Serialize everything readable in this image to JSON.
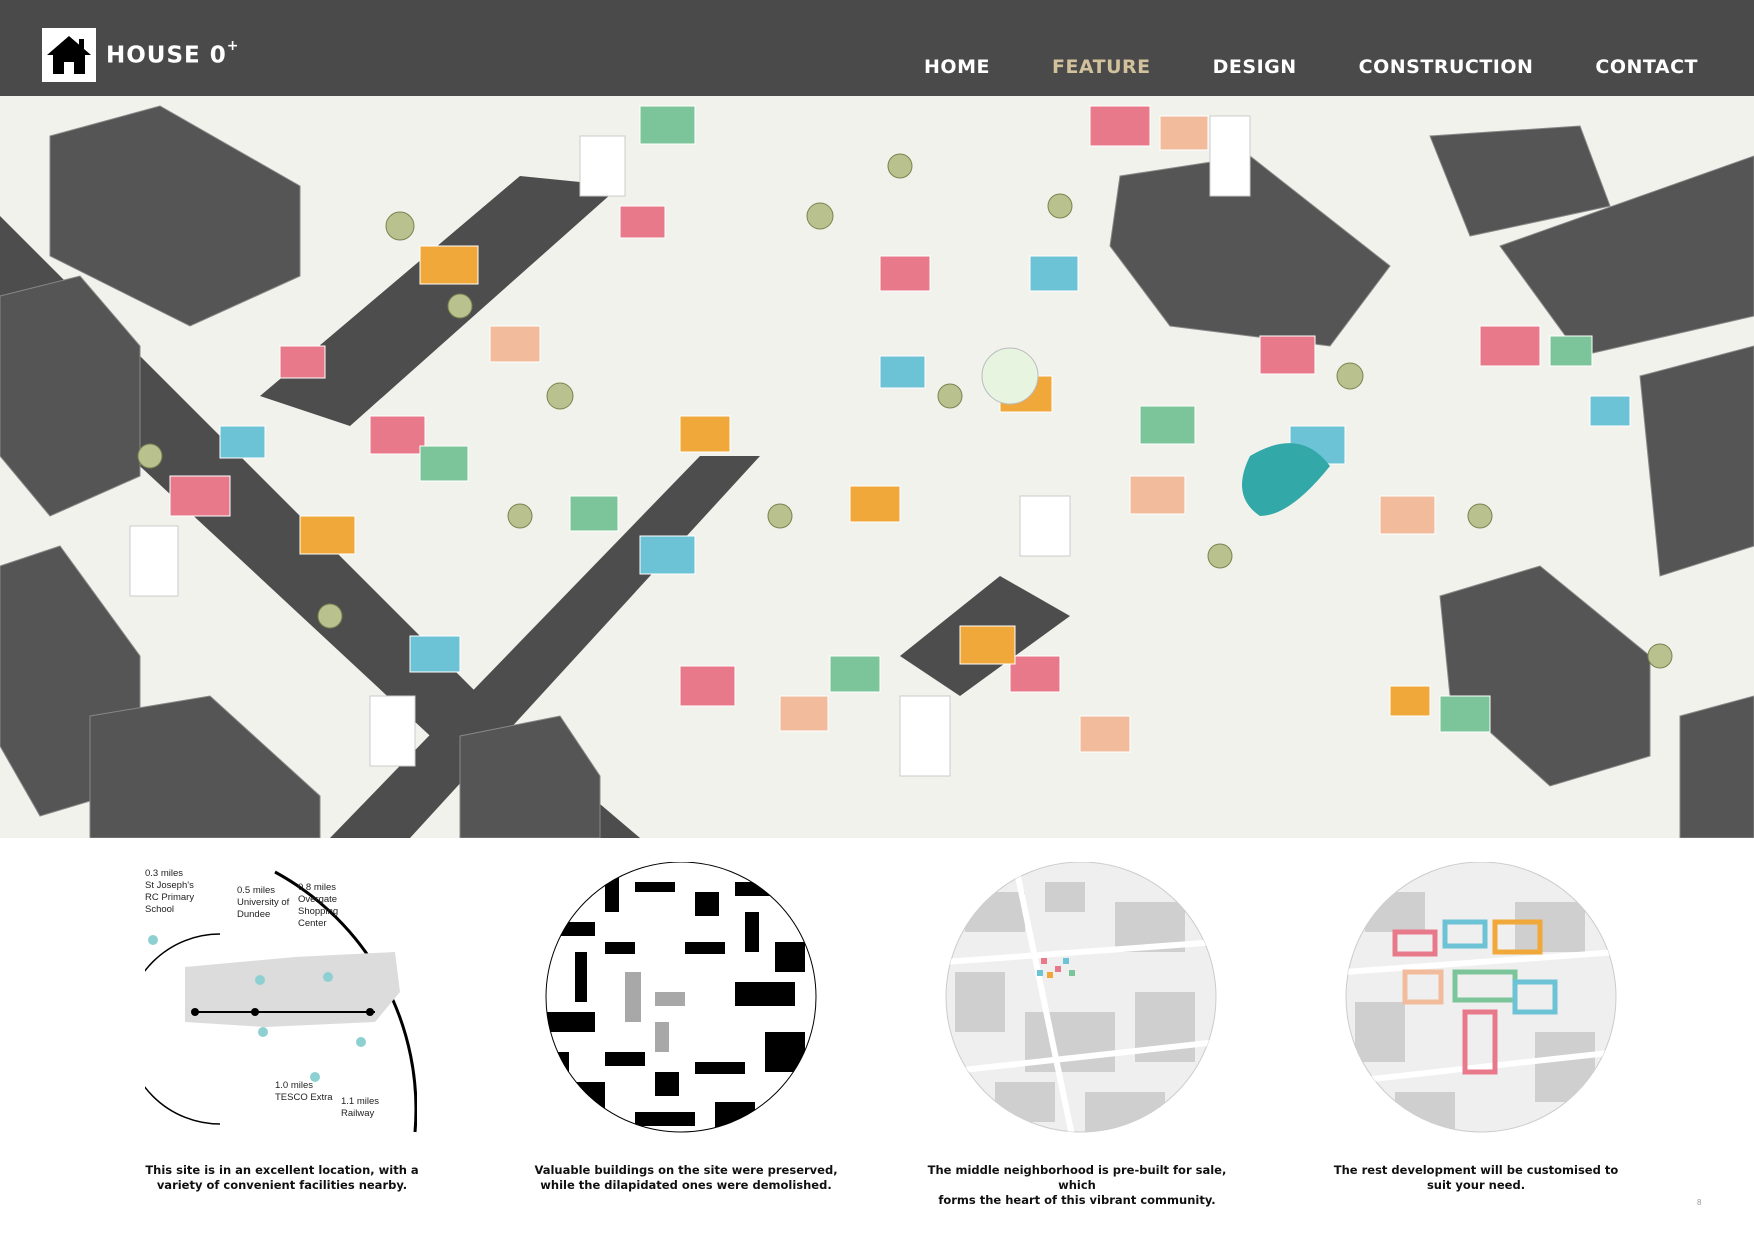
{
  "header": {
    "brand_name": "HOUSE 0",
    "brand_sup": "+",
    "logo_icon": "house-icon",
    "nav": [
      {
        "label": "HOME",
        "active": false
      },
      {
        "label": "FEATURE",
        "active": true
      },
      {
        "label": "DESIGN",
        "active": false
      },
      {
        "label": "CONSTRUCTION",
        "active": false
      },
      {
        "label": "CONTACT",
        "active": false
      }
    ],
    "colors": {
      "bar": "#4a4a4a",
      "nav_text": "#ffffff",
      "nav_active": "#d2c29c"
    }
  },
  "hero": {
    "image_icon": "isometric-neighborhood-illustration",
    "palette": [
      "#e8798a",
      "#f0a83a",
      "#6cc3d5",
      "#7cc49a",
      "#f2bc9c",
      "#d9eef2",
      "#e3efcf",
      "#ffffff",
      "#505050"
    ]
  },
  "features": [
    {
      "caption_line1": "This site is in an excellent location, with a",
      "caption_line2": "variety of convenient facilities nearby.",
      "diagram": {
        "labels": {
          "school": [
            "0.3 miles",
            "St Joseph's",
            "RC Primary",
            "School"
          ],
          "university": [
            "0.5 miles",
            "University of",
            "Dundee"
          ],
          "shopping": [
            "0.8 miles",
            "Overgate",
            "Shopping",
            "Center"
          ],
          "tesco": [
            "1.0 miles",
            "TESCO Extra"
          ],
          "railway": [
            "1.1 miles",
            "Railway"
          ]
        }
      }
    },
    {
      "caption_line1": "Valuable buildings on the site were preserved,",
      "caption_line2": "while the dilapidated ones were demolished."
    },
    {
      "caption_line1": "The middle neighborhood is pre-built for sale, which",
      "caption_line2": "forms the heart of this vibrant community."
    },
    {
      "caption_line1": "The rest development will be customised to",
      "caption_line2": "suit your need."
    }
  ],
  "page_number": "8"
}
